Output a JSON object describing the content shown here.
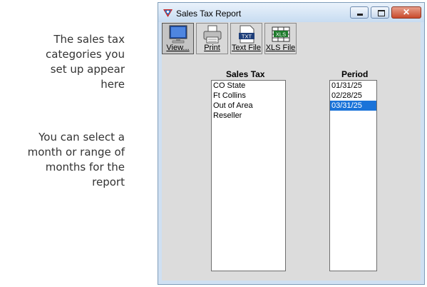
{
  "annotations": {
    "note1_lines": [
      "The sales tax",
      "categories you",
      "set up appear",
      "here"
    ],
    "note2_lines": [
      "You can select a",
      "month or range of",
      "months for the",
      "report"
    ]
  },
  "window": {
    "title": "Sales Tax Report",
    "close_symbol": "✕"
  },
  "toolbar": {
    "view_label": "View...",
    "print_label": "Print",
    "text_file_label": "Text File",
    "xls_file_label": "XLS File",
    "txt_icon_text": "TXT",
    "xls_icon_text": "XLS"
  },
  "sales_tax": {
    "header": "Sales Tax",
    "items": [
      "CO State",
      "Ft Collins",
      "Out of Area",
      "Reseller"
    ]
  },
  "period": {
    "header": "Period",
    "items": [
      "01/31/25",
      "02/28/25",
      "03/31/25"
    ],
    "selected": "03/31/25"
  },
  "colors": {
    "selection": "#1a73d9",
    "window_frame": "#cfe0f2",
    "close_button": "#c94a2c"
  }
}
